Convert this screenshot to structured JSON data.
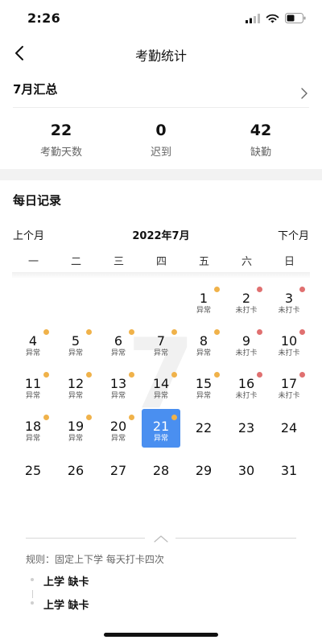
{
  "status_bar": {
    "time": "2:26"
  },
  "nav": {
    "title": "考勤统计"
  },
  "summary": {
    "title": "7月汇总",
    "stats": [
      {
        "value": "22",
        "label": "考勤天数"
      },
      {
        "value": "0",
        "label": "迟到"
      },
      {
        "value": "42",
        "label": "缺勤"
      }
    ]
  },
  "daily": {
    "title": "每日记录",
    "prev_label": "上个月",
    "month_label": "2022年7月",
    "next_label": "下个月",
    "weekdays": [
      "一",
      "二",
      "三",
      "四",
      "五",
      "六",
      "日"
    ],
    "watermark": "7",
    "days": [
      {
        "day": "1",
        "status": "异常",
        "dot": "orange"
      },
      {
        "day": "2",
        "status": "未打卡",
        "dot": "red"
      },
      {
        "day": "3",
        "status": "未打卡",
        "dot": "red"
      },
      {
        "day": "4",
        "status": "异常",
        "dot": "orange"
      },
      {
        "day": "5",
        "status": "异常",
        "dot": "orange"
      },
      {
        "day": "6",
        "status": "异常",
        "dot": "orange"
      },
      {
        "day": "7",
        "status": "异常",
        "dot": "orange"
      },
      {
        "day": "8",
        "status": "异常",
        "dot": "orange"
      },
      {
        "day": "9",
        "status": "未打卡",
        "dot": "red"
      },
      {
        "day": "10",
        "status": "未打卡",
        "dot": "red"
      },
      {
        "day": "11",
        "status": "异常",
        "dot": "orange"
      },
      {
        "day": "12",
        "status": "异常",
        "dot": "orange"
      },
      {
        "day": "13",
        "status": "异常",
        "dot": "orange"
      },
      {
        "day": "14",
        "status": "异常",
        "dot": "orange"
      },
      {
        "day": "15",
        "status": "异常",
        "dot": "orange"
      },
      {
        "day": "16",
        "status": "未打卡",
        "dot": "red"
      },
      {
        "day": "17",
        "status": "未打卡",
        "dot": "red"
      },
      {
        "day": "18",
        "status": "异常",
        "dot": "orange"
      },
      {
        "day": "19",
        "status": "异常",
        "dot": "orange"
      },
      {
        "day": "20",
        "status": "异常",
        "dot": "orange"
      },
      {
        "day": "21",
        "status": "异常",
        "dot": "orange",
        "selected": true
      },
      {
        "day": "22",
        "status": "",
        "dot": ""
      },
      {
        "day": "23",
        "status": "",
        "dot": ""
      },
      {
        "day": "24",
        "status": "",
        "dot": ""
      },
      {
        "day": "25",
        "status": "",
        "dot": ""
      },
      {
        "day": "26",
        "status": "",
        "dot": ""
      },
      {
        "day": "27",
        "status": "",
        "dot": ""
      },
      {
        "day": "28",
        "status": "",
        "dot": ""
      },
      {
        "day": "29",
        "status": "",
        "dot": ""
      },
      {
        "day": "30",
        "status": "",
        "dot": ""
      },
      {
        "day": "31",
        "status": "",
        "dot": ""
      }
    ]
  },
  "rules": {
    "text": "规则：固定上下学 每天打卡四次",
    "items": [
      "上学 缺卡",
      "上学 缺卡"
    ]
  },
  "colors": {
    "accent": "#4a8ff0",
    "abnormal_dot": "#f0b24a",
    "missing_dot": "#e07070"
  },
  "icons": {
    "back": "chevron-left-icon",
    "summary_arrow": "chevron-right-icon",
    "collapse": "chevron-up-icon"
  }
}
